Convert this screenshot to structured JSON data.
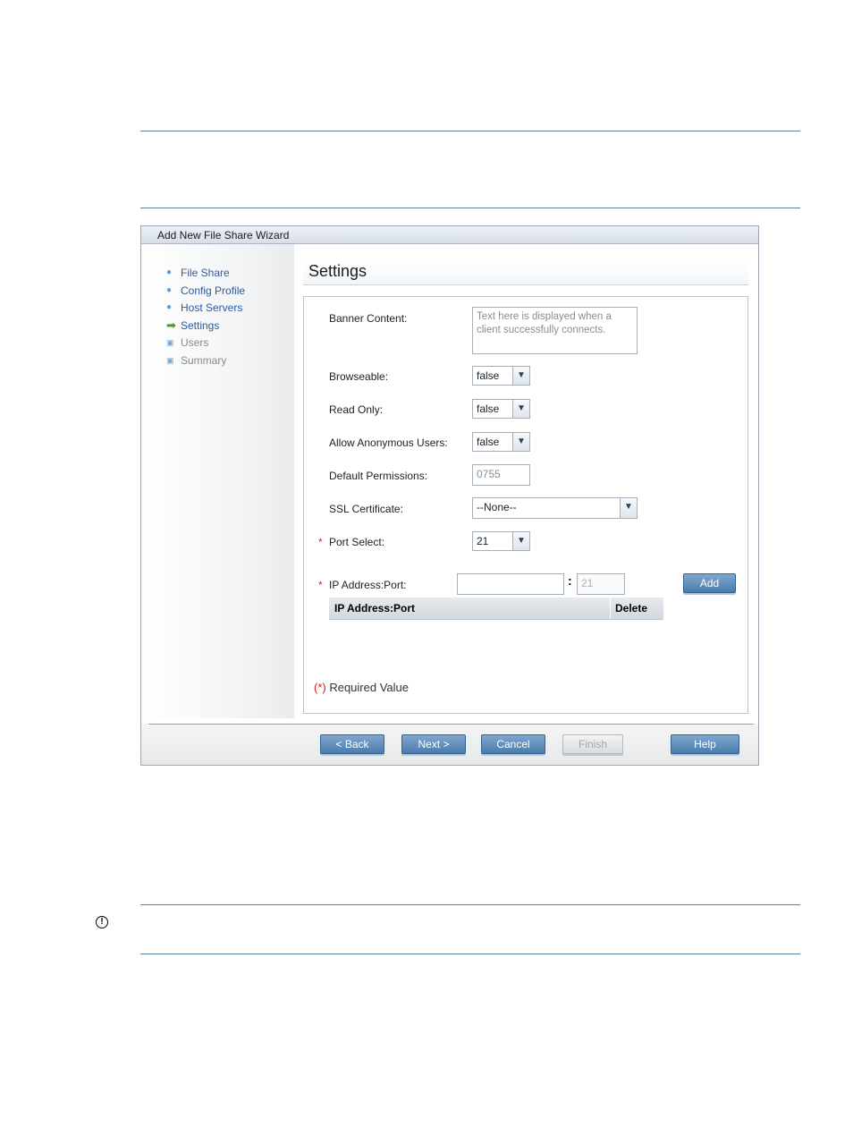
{
  "wizard": {
    "title": "Add New File Share Wizard",
    "steps": [
      {
        "label": "File Share",
        "state": "done",
        "icon": "bullet-icon"
      },
      {
        "label": "Config Profile",
        "state": "done",
        "icon": "bullet-icon"
      },
      {
        "label": "Host Servers",
        "state": "done",
        "icon": "bullet-icon"
      },
      {
        "label": "Settings",
        "state": "active",
        "icon": "arrow-right-icon"
      },
      {
        "label": "Users",
        "state": "todo",
        "icon": "square-bullet-icon"
      },
      {
        "label": "Summary",
        "state": "todo",
        "icon": "square-bullet-icon"
      }
    ],
    "section_title": "Settings",
    "form": {
      "banner_label": "Banner Content:",
      "banner_placeholder": "Text here is displayed when a client successfully connects.",
      "browseable_label": "Browseable:",
      "browseable_value": "false",
      "readonly_label": "Read Only:",
      "readonly_value": "false",
      "anonymous_label": "Allow Anonymous Users:",
      "anonymous_value": "false",
      "permissions_label": "Default Permissions:",
      "permissions_value": "0755",
      "ssl_label": "SSL Certificate:",
      "ssl_value": "--None--",
      "port_label": "Port Select:",
      "port_value": "21",
      "ip_label": "IP Address:Port:",
      "ip_value": "",
      "ip_separator": ":",
      "ip_port_value": "21",
      "add_label": "Add",
      "table_col1": "IP Address:Port",
      "table_col2": "Delete",
      "required_star": "*",
      "required_note_mark": "(*)",
      "required_note_text": " Required Value"
    },
    "buttons": {
      "back": "< Back",
      "next": "Next >",
      "cancel": "Cancel",
      "finish": "Finish",
      "help": "Help"
    }
  },
  "important_icon": "!"
}
